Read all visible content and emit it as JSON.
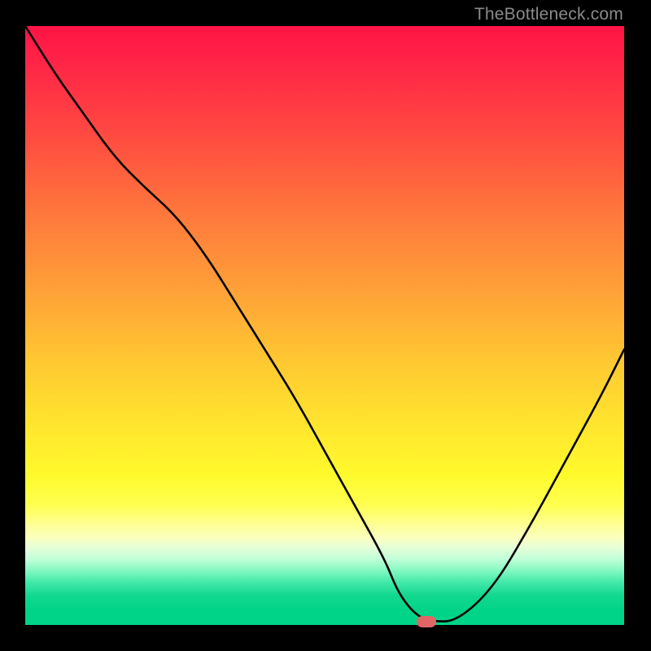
{
  "watermark": "TheBottleneck.com",
  "marker_color": "#e06666",
  "chart_data": {
    "type": "line",
    "title": "",
    "xlabel": "",
    "ylabel": "",
    "xlim": [
      0,
      100
    ],
    "ylim": [
      0,
      100
    ],
    "grid": false,
    "legend": false,
    "gradient_meaning": "vertical color scale from red (top, bad / high bottleneck) to green (bottom, good / low bottleneck)",
    "series": [
      {
        "name": "bottleneck-curve",
        "x": [
          0,
          5,
          10,
          15,
          20,
          25,
          30,
          35,
          40,
          45,
          50,
          55,
          60,
          62,
          64,
          66,
          68,
          72,
          78,
          84,
          90,
          96,
          100
        ],
        "y": [
          100,
          92,
          85,
          78,
          73,
          68.5,
          62,
          54,
          46,
          38,
          29,
          20,
          11,
          6,
          3,
          1.2,
          0.6,
          0.6,
          6,
          16,
          27,
          38,
          46
        ]
      }
    ],
    "marker": {
      "x_percent": 67,
      "y_percent": 0.6
    }
  }
}
